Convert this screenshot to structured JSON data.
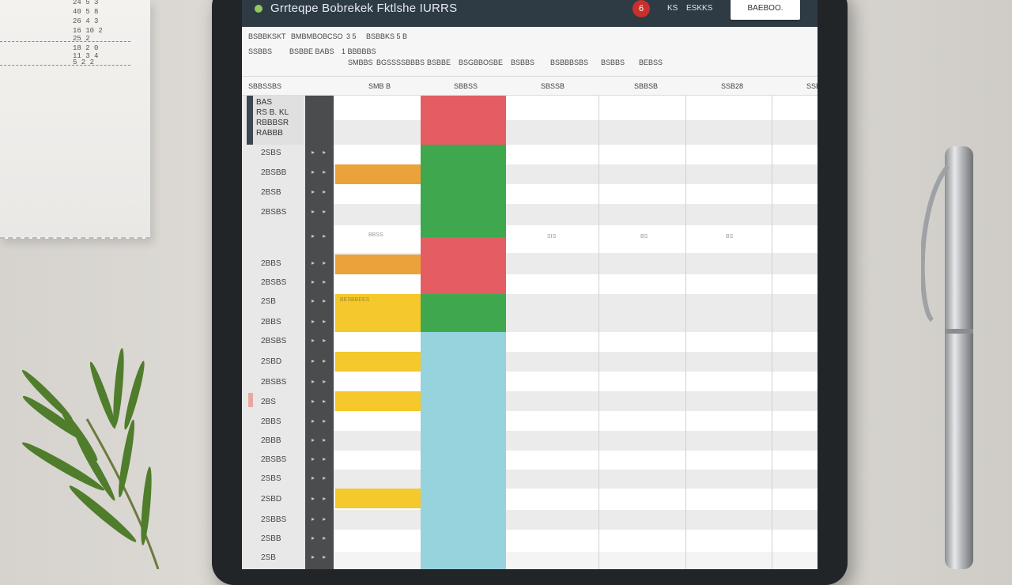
{
  "paper": {
    "lines": [
      "24 5 3",
      "40 5 8",
      "26 4 3",
      "16 10 2",
      "18 2 0",
      "11 3 4",
      "25 2",
      "5 2 2"
    ]
  },
  "app": {
    "title": "Grrteqpe Bobrekek Fktlshe IURRS",
    "alert_count": "6",
    "aux_left": "KS",
    "aux_right": "ESKKS",
    "top_button": "BAEBOO."
  },
  "toolbar": {
    "row1": [
      "BSBBKSKT",
      "BMBMBOBCSO",
      "3 5",
      "BSBBKS 5 B"
    ],
    "row2": [
      "SSBBS",
      "BSBBE BABS",
      "1 BBBBBS",
      "SMBBS",
      "BGSSSSBBBS",
      "BSBBE",
      "BSGBBOSBE",
      "BSBBS",
      "BSBBBSBS",
      "BSBBS",
      "BEBSS"
    ]
  },
  "columns": {
    "first": "SBBSSBS",
    "headers": [
      "SMB B",
      "SBBSS",
      "SBSSB",
      "SBBSB",
      "SSB28",
      "SSB"
    ]
  },
  "header_cell": [
    "BAS",
    "RS B. KL",
    "RBBBSR",
    "RABBB"
  ],
  "rows": [
    "2SBS",
    "2BSBB",
    "2BSB",
    "2BSBS",
    "",
    "2BBS",
    "2BSBS",
    "2SB",
    "2BBS",
    "2BSBS",
    "2SBD",
    "2BSBS",
    "2BS",
    "2BBS",
    "2BBB",
    "2BSBS",
    "2SBS",
    "2SBD",
    "2SBBS",
    "2SBB",
    "2SB"
  ],
  "notes": {
    "inline_note": "BESBBEES",
    "ticks": [
      "BBSS",
      "SIS",
      "BS",
      "BS"
    ]
  },
  "colors": {
    "red": "#e35d62",
    "green": "#3fa84f",
    "orange": "#eba23b",
    "yellow": "#f5c82c",
    "cyan": "#96d3dd",
    "titlebar": "#2e3a44"
  }
}
